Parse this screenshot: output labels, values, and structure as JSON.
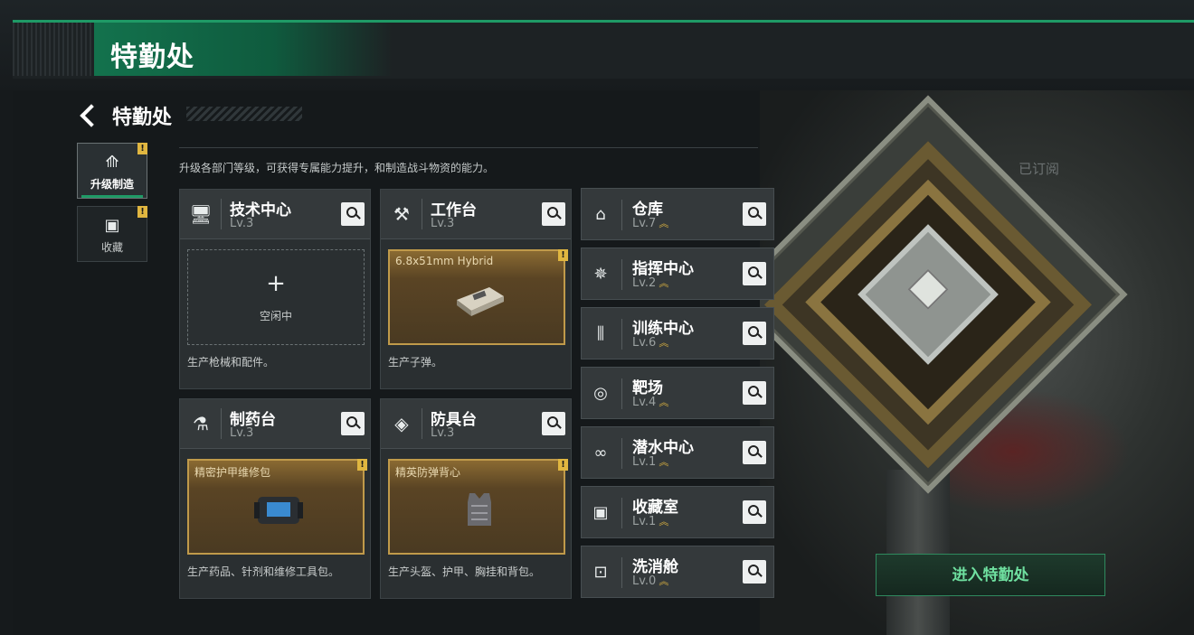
{
  "header": {
    "title": "特勤处"
  },
  "nav": {
    "back_title": "特勤处"
  },
  "description": "升级各部门等级，可获得专属能力提升，和制造战斗物资的能力。",
  "side_tabs": [
    {
      "label": "升级制造",
      "icon": "upgrade-icon",
      "active": true
    },
    {
      "label": "收藏",
      "icon": "collection-icon",
      "active": false
    }
  ],
  "cards": [
    {
      "name": "技术中心",
      "level": "Lv.3",
      "icon": "monitor-icon",
      "slot_state": "empty",
      "slot_plus": "+",
      "slot_text": "空闲中",
      "footer": "生产枪械和配件。"
    },
    {
      "name": "工作台",
      "level": "Lv.3",
      "icon": "tools-icon",
      "slot_state": "item",
      "slot_text": "6.8x51mm Hybrid",
      "footer": "生产子弹。"
    },
    {
      "name": "制药台",
      "level": "Lv.3",
      "icon": "microscope-icon",
      "slot_state": "item",
      "slot_text": "精密护甲维修包",
      "footer": "生产药品、针剂和维修工具包。"
    },
    {
      "name": "防具台",
      "level": "Lv.3",
      "icon": "armor-blocks-icon",
      "slot_state": "item",
      "slot_text": "精英防弹背心",
      "footer": "生产头盔、护甲、胸挂和背包。"
    }
  ],
  "facilities": [
    {
      "name": "仓库",
      "level": "Lv.7",
      "icon": "warehouse-icon"
    },
    {
      "name": "指挥中心",
      "level": "Lv.2",
      "icon": "command-icon"
    },
    {
      "name": "训练中心",
      "level": "Lv.6",
      "icon": "dumbbell-icon"
    },
    {
      "name": "靶场",
      "level": "Lv.4",
      "icon": "target-icon"
    },
    {
      "name": "潜水中心",
      "level": "Lv.1",
      "icon": "diving-mask-icon"
    },
    {
      "name": "收藏室",
      "level": "Lv.1",
      "icon": "collection-room-icon"
    },
    {
      "name": "洗消舱",
      "level": "Lv.0",
      "icon": "decon-icon"
    }
  ],
  "subscribed_label": "已订阅",
  "enter_button": "进入特勤处",
  "colors": {
    "accent_green": "#1f9a66",
    "warning_yellow": "#e0b640",
    "item_border": "#c09a4a"
  }
}
